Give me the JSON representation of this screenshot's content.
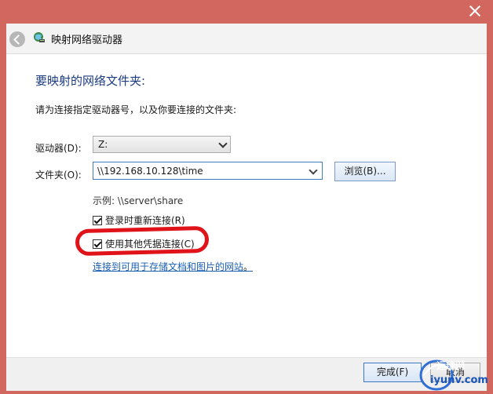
{
  "window": {
    "title": "映射网络驱动器"
  },
  "main": {
    "heading": "要映射的网络文件夹:",
    "instructions": "请为连接指定驱动器号，以及你要连接的文件夹:"
  },
  "form": {
    "drive_label": "驱动器(D):",
    "drive_value": "Z:",
    "folder_label": "文件夹(O):",
    "folder_value": "\\\\192.168.10.128\\time",
    "browse_label": "浏览(B)...",
    "example": "示例: \\\\server\\share",
    "reconnect_label": "登录时重新连接(R)",
    "reconnect_checked": true,
    "other_credentials_label": "使用其他凭据连接(C)",
    "other_credentials_checked": true,
    "link_text": "连接到可用于存储文档和图片的网站",
    "link_suffix": "。"
  },
  "footer": {
    "finish_label": "完成(F)",
    "cancel_label": "取消"
  },
  "watermark": {
    "text_top": "运维网",
    "text_bottom": "iyunv.com"
  },
  "colors": {
    "frame": "#d2675f",
    "heading": "#1c3b82",
    "link": "#1a5fb4",
    "annotation": "#e0121a"
  }
}
